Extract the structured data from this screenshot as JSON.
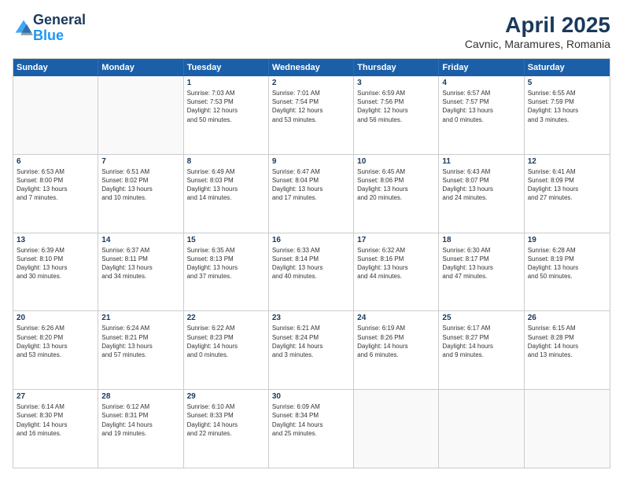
{
  "header": {
    "logo_line1": "General",
    "logo_line2": "Blue",
    "month_year": "April 2025",
    "location": "Cavnic, Maramures, Romania"
  },
  "weekdays": [
    "Sunday",
    "Monday",
    "Tuesday",
    "Wednesday",
    "Thursday",
    "Friday",
    "Saturday"
  ],
  "rows": [
    [
      {
        "day": "",
        "text": ""
      },
      {
        "day": "",
        "text": ""
      },
      {
        "day": "1",
        "text": "Sunrise: 7:03 AM\nSunset: 7:53 PM\nDaylight: 12 hours\nand 50 minutes."
      },
      {
        "day": "2",
        "text": "Sunrise: 7:01 AM\nSunset: 7:54 PM\nDaylight: 12 hours\nand 53 minutes."
      },
      {
        "day": "3",
        "text": "Sunrise: 6:59 AM\nSunset: 7:56 PM\nDaylight: 12 hours\nand 56 minutes."
      },
      {
        "day": "4",
        "text": "Sunrise: 6:57 AM\nSunset: 7:57 PM\nDaylight: 13 hours\nand 0 minutes."
      },
      {
        "day": "5",
        "text": "Sunrise: 6:55 AM\nSunset: 7:59 PM\nDaylight: 13 hours\nand 3 minutes."
      }
    ],
    [
      {
        "day": "6",
        "text": "Sunrise: 6:53 AM\nSunset: 8:00 PM\nDaylight: 13 hours\nand 7 minutes."
      },
      {
        "day": "7",
        "text": "Sunrise: 6:51 AM\nSunset: 8:02 PM\nDaylight: 13 hours\nand 10 minutes."
      },
      {
        "day": "8",
        "text": "Sunrise: 6:49 AM\nSunset: 8:03 PM\nDaylight: 13 hours\nand 14 minutes."
      },
      {
        "day": "9",
        "text": "Sunrise: 6:47 AM\nSunset: 8:04 PM\nDaylight: 13 hours\nand 17 minutes."
      },
      {
        "day": "10",
        "text": "Sunrise: 6:45 AM\nSunset: 8:06 PM\nDaylight: 13 hours\nand 20 minutes."
      },
      {
        "day": "11",
        "text": "Sunrise: 6:43 AM\nSunset: 8:07 PM\nDaylight: 13 hours\nand 24 minutes."
      },
      {
        "day": "12",
        "text": "Sunrise: 6:41 AM\nSunset: 8:09 PM\nDaylight: 13 hours\nand 27 minutes."
      }
    ],
    [
      {
        "day": "13",
        "text": "Sunrise: 6:39 AM\nSunset: 8:10 PM\nDaylight: 13 hours\nand 30 minutes."
      },
      {
        "day": "14",
        "text": "Sunrise: 6:37 AM\nSunset: 8:11 PM\nDaylight: 13 hours\nand 34 minutes."
      },
      {
        "day": "15",
        "text": "Sunrise: 6:35 AM\nSunset: 8:13 PM\nDaylight: 13 hours\nand 37 minutes."
      },
      {
        "day": "16",
        "text": "Sunrise: 6:33 AM\nSunset: 8:14 PM\nDaylight: 13 hours\nand 40 minutes."
      },
      {
        "day": "17",
        "text": "Sunrise: 6:32 AM\nSunset: 8:16 PM\nDaylight: 13 hours\nand 44 minutes."
      },
      {
        "day": "18",
        "text": "Sunrise: 6:30 AM\nSunset: 8:17 PM\nDaylight: 13 hours\nand 47 minutes."
      },
      {
        "day": "19",
        "text": "Sunrise: 6:28 AM\nSunset: 8:19 PM\nDaylight: 13 hours\nand 50 minutes."
      }
    ],
    [
      {
        "day": "20",
        "text": "Sunrise: 6:26 AM\nSunset: 8:20 PM\nDaylight: 13 hours\nand 53 minutes."
      },
      {
        "day": "21",
        "text": "Sunrise: 6:24 AM\nSunset: 8:21 PM\nDaylight: 13 hours\nand 57 minutes."
      },
      {
        "day": "22",
        "text": "Sunrise: 6:22 AM\nSunset: 8:23 PM\nDaylight: 14 hours\nand 0 minutes."
      },
      {
        "day": "23",
        "text": "Sunrise: 6:21 AM\nSunset: 8:24 PM\nDaylight: 14 hours\nand 3 minutes."
      },
      {
        "day": "24",
        "text": "Sunrise: 6:19 AM\nSunset: 8:26 PM\nDaylight: 14 hours\nand 6 minutes."
      },
      {
        "day": "25",
        "text": "Sunrise: 6:17 AM\nSunset: 8:27 PM\nDaylight: 14 hours\nand 9 minutes."
      },
      {
        "day": "26",
        "text": "Sunrise: 6:15 AM\nSunset: 8:28 PM\nDaylight: 14 hours\nand 13 minutes."
      }
    ],
    [
      {
        "day": "27",
        "text": "Sunrise: 6:14 AM\nSunset: 8:30 PM\nDaylight: 14 hours\nand 16 minutes."
      },
      {
        "day": "28",
        "text": "Sunrise: 6:12 AM\nSunset: 8:31 PM\nDaylight: 14 hours\nand 19 minutes."
      },
      {
        "day": "29",
        "text": "Sunrise: 6:10 AM\nSunset: 8:33 PM\nDaylight: 14 hours\nand 22 minutes."
      },
      {
        "day": "30",
        "text": "Sunrise: 6:09 AM\nSunset: 8:34 PM\nDaylight: 14 hours\nand 25 minutes."
      },
      {
        "day": "",
        "text": ""
      },
      {
        "day": "",
        "text": ""
      },
      {
        "day": "",
        "text": ""
      }
    ]
  ]
}
